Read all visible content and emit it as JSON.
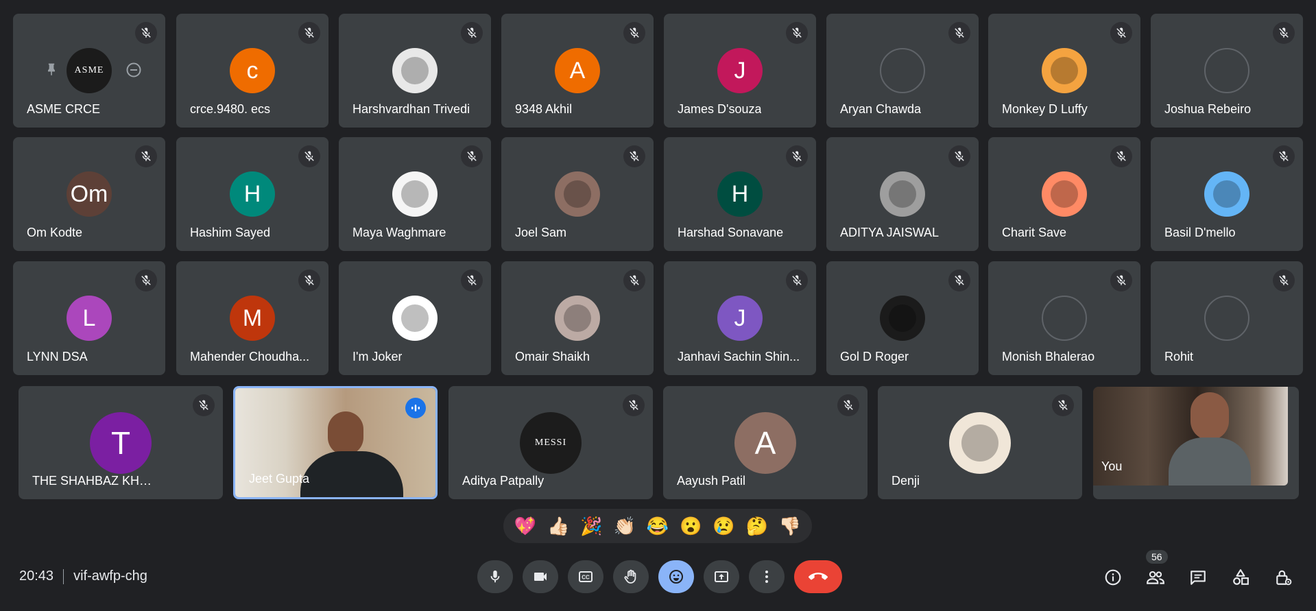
{
  "participants_grid": [
    {
      "name": "ASME CRCE",
      "avatar": {
        "type": "logo",
        "text": "ASME",
        "bg": "#1b1b1b"
      },
      "hover_controls": true
    },
    {
      "name": "crce.9480. ecs",
      "avatar": {
        "type": "letter",
        "text": "c",
        "bg": "#ef6c00"
      }
    },
    {
      "name": "Harshvardhan Trivedi",
      "avatar": {
        "type": "image",
        "text": "",
        "bg": "#e8e8e8"
      }
    },
    {
      "name": "9348 Akhil",
      "avatar": {
        "type": "letter",
        "text": "A",
        "bg": "#ef6c00"
      }
    },
    {
      "name": "James D'souza",
      "avatar": {
        "type": "letter",
        "text": "J",
        "bg": "#c2185b"
      }
    },
    {
      "name": "Aryan Chawda",
      "avatar": {
        "type": "empty",
        "text": "",
        "bg": "#3c4043"
      }
    },
    {
      "name": "Monkey D Luffy",
      "avatar": {
        "type": "image",
        "text": "",
        "bg": "#f4a340"
      }
    },
    {
      "name": "Joshua Rebeiro",
      "avatar": {
        "type": "empty",
        "text": "",
        "bg": "#3c4043"
      }
    },
    {
      "name": "Om Kodte",
      "avatar": {
        "type": "letter",
        "text": "Om",
        "bg": "#5d4037"
      }
    },
    {
      "name": "Hashim Sayed",
      "avatar": {
        "type": "letter",
        "text": "H",
        "bg": "#00897b"
      }
    },
    {
      "name": "Maya Waghmare",
      "avatar": {
        "type": "image",
        "text": "",
        "bg": "#f5f5f5"
      }
    },
    {
      "name": "Joel Sam",
      "avatar": {
        "type": "image",
        "text": "",
        "bg": "#8d6e63"
      }
    },
    {
      "name": "Harshad Sonavane",
      "avatar": {
        "type": "letter",
        "text": "H",
        "bg": "#004d40"
      }
    },
    {
      "name": "ADITYA JAISWAL",
      "avatar": {
        "type": "image",
        "text": "",
        "bg": "#9e9e9e"
      }
    },
    {
      "name": "Charit Save",
      "avatar": {
        "type": "image",
        "text": "",
        "bg": "#ff8a65"
      }
    },
    {
      "name": "Basil D'mello",
      "avatar": {
        "type": "image",
        "text": "",
        "bg": "#64b5f6"
      }
    },
    {
      "name": "LYNN DSA",
      "avatar": {
        "type": "letter",
        "text": "L",
        "bg": "#ab47bc"
      }
    },
    {
      "name": "Mahender Choudha...",
      "avatar": {
        "type": "letter",
        "text": "M",
        "bg": "#bf360c"
      }
    },
    {
      "name": "I'm Joker",
      "avatar": {
        "type": "image",
        "text": "",
        "bg": "#ffffff"
      }
    },
    {
      "name": "Omair Shaikh",
      "avatar": {
        "type": "image",
        "text": "",
        "bg": "#bcaaa4"
      }
    },
    {
      "name": "Janhavi Sachin Shin...",
      "avatar": {
        "type": "letter",
        "text": "J",
        "bg": "#7e57c2"
      }
    },
    {
      "name": "Gol D Roger",
      "avatar": {
        "type": "image",
        "text": "",
        "bg": "#1b1b1b"
      }
    },
    {
      "name": "Monish Bhalerao",
      "avatar": {
        "type": "empty",
        "text": "",
        "bg": "#3c4043"
      }
    },
    {
      "name": "Rohit",
      "avatar": {
        "type": "empty",
        "text": "",
        "bg": "#3c4043"
      }
    }
  ],
  "participants_bottom": [
    {
      "name": "THE SHAHBAZ KHAN",
      "avatar": {
        "type": "letter",
        "text": "T",
        "bg": "#7b1fa2"
      }
    },
    {
      "name": "Jeet Gupta",
      "avatar": {
        "type": "video",
        "text": "",
        "bg": "#b59a7e"
      },
      "speaking": true
    },
    {
      "name": "Aditya Patpally",
      "avatar": {
        "type": "logo",
        "text": "MESSI",
        "bg": "#1c1c1c"
      }
    },
    {
      "name": "Aayush Patil",
      "avatar": {
        "type": "letter",
        "text": "A",
        "bg": "#8d6e63"
      }
    },
    {
      "name": "Denji",
      "avatar": {
        "type": "image",
        "text": "",
        "bg": "#f0e6d8"
      }
    }
  ],
  "self_view": {
    "label": "You"
  },
  "reactions": [
    "💖",
    "👍🏻",
    "🎉",
    "👏🏻",
    "😂",
    "😮",
    "😢",
    "🤔",
    "👎🏻"
  ],
  "meeting": {
    "time": "20:43",
    "code": "vif-awfp-chg"
  },
  "people_count": "56",
  "colors": {
    "background": "#202124",
    "tile": "#3c4043",
    "accent": "#8ab4f8",
    "end_call": "#ea4335",
    "speaking": "#1a73e8"
  },
  "controls": [
    "mic-icon",
    "camera-icon",
    "captions-icon",
    "raise-hand-icon",
    "emoji-icon",
    "present-icon",
    "more-icon",
    "end-call-icon"
  ],
  "right_icons": [
    "info-icon",
    "people-icon",
    "chat-icon",
    "activities-icon",
    "host-controls-icon"
  ]
}
